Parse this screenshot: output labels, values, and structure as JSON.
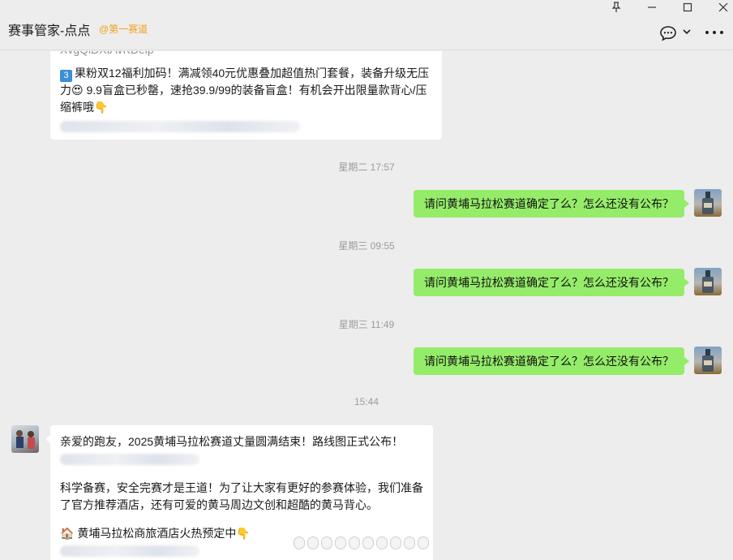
{
  "window": {
    "title": "赛事管家-点点",
    "tag": "@第一赛道",
    "controls": {
      "pin": "⊥",
      "minimize": "—",
      "maximize": "☐",
      "close": "✕"
    }
  },
  "messages": {
    "top_cut_text": "XvgQiDXtAvKDeip",
    "top_line1_badge": "3",
    "top_paragraph": "果粉双12福利加码！满减领40元优惠叠加超值热门套餐，装备升级无压力😍 9.9盲盒已秒罄，速抢39.9/99的装备盲盒！有机会开出限量款背心/压缩裤哦👇",
    "ts1": "星期二 17:57",
    "m1": "请问黄埔马拉松赛道确定了么？怎么还没有公布？",
    "ts2": "星期三 09:55",
    "m2": "请问黄埔马拉松赛道确定了么？怎么还没有公布？",
    "ts3": "星期三 11:49",
    "m3": "请问黄埔马拉松赛道确定了么？怎么还没有公布？",
    "ts4": "15:44",
    "reply_line1": "亲爱的跑友，2025黄埔马拉松赛道丈量圆满结束！路线图正式公布！",
    "reply_para2": "科学备赛，安全完赛才是王道！为了让大家有更好的参赛体验，我们准备了官方推荐酒店，还有可爱的黄马周边文创和超酷的黄马背心。",
    "reply_line3": "🏠 黄埔马拉松商旅酒店火热预定中👇"
  },
  "icons": {
    "chat": "chat-bubble-icon",
    "chevron": "chevron-down-icon",
    "more": "more-icon"
  }
}
